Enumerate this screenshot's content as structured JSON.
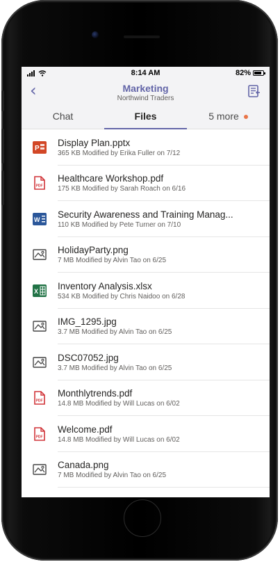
{
  "status_bar": {
    "time": "8:14 AM",
    "battery": "82%"
  },
  "header": {
    "title": "Marketing",
    "subtitle": "Northwind Traders"
  },
  "tabs": [
    {
      "label": "Chat",
      "active": false
    },
    {
      "label": "Files",
      "active": true
    },
    {
      "label": "5 more",
      "active": false
    }
  ],
  "colors": {
    "accent": "#6264a7",
    "notification_dot": "#e97548",
    "ppt": "#d24726",
    "pdf": "#d13438",
    "word": "#2b579a",
    "excel": "#217346"
  },
  "files": [
    {
      "name": "Display Plan.pptx",
      "meta": "365 KB Modified by Erika Fuller on 7/12",
      "icon": "powerpoint-icon"
    },
    {
      "name": "Healthcare Workshop.pdf",
      "meta": "175 KB  Modified by Sarah Roach on 6/16",
      "icon": "pdf-icon"
    },
    {
      "name": "Security Awareness and Training Manag...",
      "meta": "110 KB Modified by Pete Turner on 7/10",
      "icon": "word-icon"
    },
    {
      "name": "HolidayParty.png",
      "meta": "7 MB Modified by Alvin Tao on 6/25",
      "icon": "image-icon"
    },
    {
      "name": "Inventory Analysis.xlsx",
      "meta": "534 KB Modified by Chris Naidoo on 6/28",
      "icon": "excel-icon"
    },
    {
      "name": "IMG_1295.jpg",
      "meta": "3.7 MB Modified by Alvin Tao on 6/25",
      "icon": "image-icon"
    },
    {
      "name": "DSC07052.jpg",
      "meta": "3.7 MB Modified by Alvin Tao on 6/25",
      "icon": "image-icon"
    },
    {
      "name": "Monthlytrends.pdf",
      "meta": "14.8 MB Modified by Will Lucas on 6/02",
      "icon": "pdf-icon"
    },
    {
      "name": "Welcome.pdf",
      "meta": "14.8 MB Modified by Will Lucas on 6/02",
      "icon": "pdf-icon"
    },
    {
      "name": "Canada.png",
      "meta": "7 MB Modified by Alvin Tao on 6/25",
      "icon": "image-icon"
    }
  ]
}
